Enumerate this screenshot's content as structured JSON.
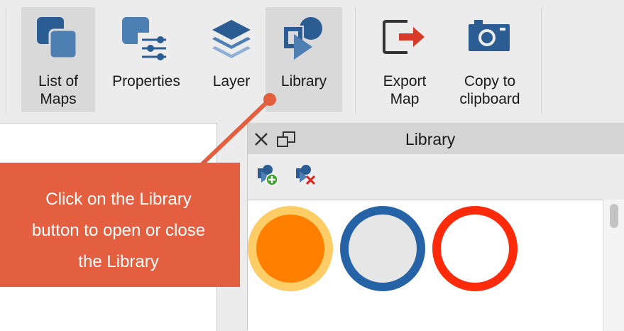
{
  "toolbar": {
    "buttons": [
      {
        "label_line1": "List of",
        "label_line2": "Maps",
        "icon": "list-of-maps-icon",
        "active": true
      },
      {
        "label": "Properties",
        "icon": "properties-icon",
        "active": false
      },
      {
        "label": "Layer",
        "icon": "layer-icon",
        "active": false
      },
      {
        "label": "Library",
        "icon": "library-icon",
        "active": true
      },
      {
        "label_line1": "Export",
        "label_line2": "Map",
        "icon": "export-map-icon",
        "active": false
      },
      {
        "label_line1": "Copy to",
        "label_line2": "clipboard",
        "icon": "camera-icon",
        "active": false
      }
    ]
  },
  "library_panel": {
    "title": "Library",
    "close_icon": "close-icon",
    "undock_icon": "undock-icon",
    "tools": [
      {
        "icon": "add-symbol-icon"
      },
      {
        "icon": "delete-symbol-icon"
      }
    ],
    "symbols": [
      {
        "name": "orange-filled-circle",
        "fill": "#ff8000",
        "stroke": "#ffcc66"
      },
      {
        "name": "blue-outline-gray-circle",
        "fill": "#e6e6e6",
        "stroke": "#2563a6"
      },
      {
        "name": "red-outline-circle",
        "fill": "#ffffff",
        "stroke": "#ff2a0a"
      }
    ]
  },
  "callout": {
    "line1": "Click on the Library",
    "line2": "button to open or close",
    "line3": "the Library",
    "color": "#e35f3f"
  },
  "colors": {
    "icon_blue": "#2b5d93",
    "icon_light_blue": "#4d7fb3",
    "export_red": "#d83a2a"
  }
}
